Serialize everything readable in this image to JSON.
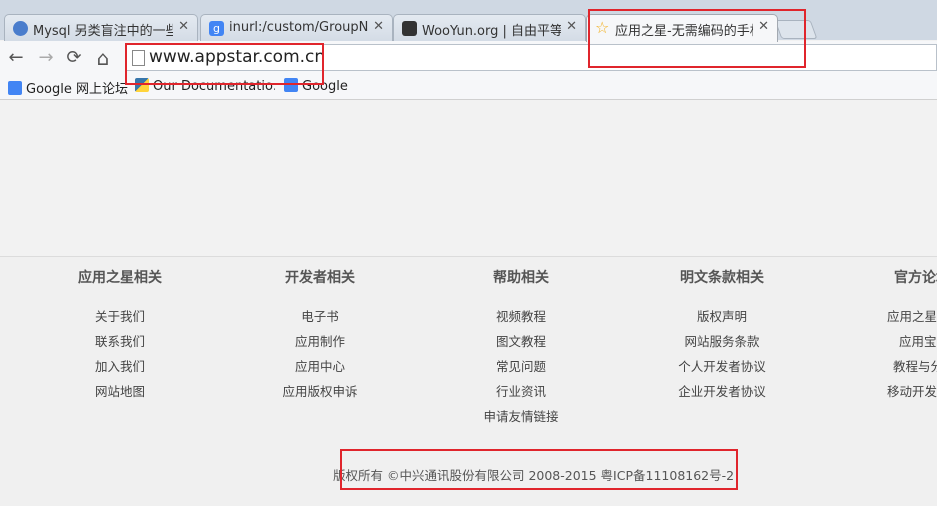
{
  "tabs": [
    {
      "title": "Mysql 另类盲注中的一些",
      "icon": "globe-icon",
      "icon_color": "#4a7dcc"
    },
    {
      "title": "inurl:/custom/GroupNe",
      "icon": "google-icon",
      "icon_color": "#4285f4"
    },
    {
      "title": "WooYun.org | 自由平等",
      "icon": "wooyun-icon",
      "icon_color": "#333333"
    },
    {
      "title": "应用之星-无需编码的手机",
      "icon": "star-icon",
      "icon_color": "#f2b01e"
    }
  ],
  "toolbar": {
    "back": "←",
    "forward": "→",
    "reload": "⟳",
    "home": "⌂",
    "url": "www.appstar.com.cn"
  },
  "bookmarks": [
    {
      "label": "Google 网上论坛",
      "icon": "google-groups-icon"
    },
    {
      "label": "Our Documentatio…",
      "icon": "python-icon"
    },
    {
      "label": "Google",
      "icon": "google-icon"
    }
  ],
  "footer": {
    "columns": [
      {
        "heading": "应用之星相关",
        "links": [
          "关于我们",
          "联系我们",
          "加入我们",
          "网站地图"
        ]
      },
      {
        "heading": "开发者相关",
        "links": [
          "电子书",
          "应用制作",
          "应用中心",
          "应用版权申诉"
        ]
      },
      {
        "heading": "帮助相关",
        "links": [
          "视频教程",
          "图文教程",
          "常见问题",
          "行业资讯",
          "申请友情链接"
        ]
      },
      {
        "heading": "明文条款相关",
        "links": [
          "版权声明",
          "网站服务条款",
          "个人开发者协议",
          "企业开发者协议"
        ]
      },
      {
        "heading": "官方论坛",
        "links": [
          "应用之星交流",
          "应用宝贝",
          "教程与分享",
          "移动开发者"
        ]
      }
    ],
    "copyright": "版权所有 ©中兴通讯股份有限公司 2008-2015 粤ICP备11108162号-2"
  },
  "colors": {
    "highlight": "#e0252c",
    "tab_active": "#f6f7f9",
    "tabstrip": "#cfd8e3"
  }
}
